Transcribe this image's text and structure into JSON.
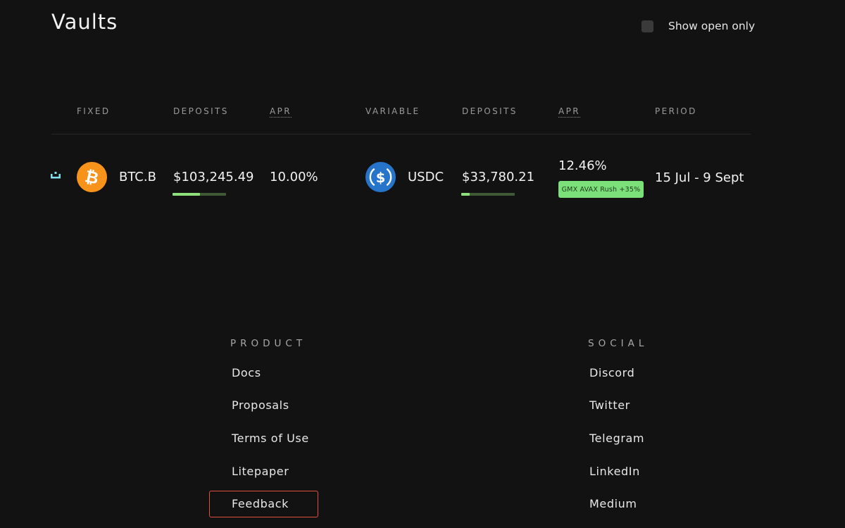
{
  "header": {
    "title": "Vaults",
    "show_open_only_label": "Show open only"
  },
  "table": {
    "headers": {
      "fixed": "FIXED",
      "fixed_deposits": "DEPOSITS",
      "fixed_apr": "APR",
      "variable": "VARIABLE",
      "variable_deposits": "DEPOSITS",
      "variable_apr": "APR",
      "period": "PERIOD"
    },
    "rows": [
      {
        "fixed_asset": "BTC.B",
        "fixed_asset_icon": "bitcoin-icon",
        "fixed_deposits": "$103,245.49",
        "fixed_deposits_progress": 0.51,
        "fixed_apr": "10.00%",
        "variable_asset": "USDC",
        "variable_asset_icon": "usdc-icon",
        "variable_deposits": "$33,780.21",
        "variable_deposits_progress": 0.16,
        "variable_apr": "12.46%",
        "variable_badge": "GMX AVAX Rush +35%",
        "period": "15 Jul - 9 Sept"
      }
    ]
  },
  "footer": {
    "product": {
      "heading": "PRODUCT",
      "links": [
        "Docs",
        "Proposals",
        "Terms of Use",
        "Litepaper",
        "Feedback"
      ]
    },
    "social": {
      "heading": "SOCIAL",
      "links": [
        "Discord",
        "Twitter",
        "Telegram",
        "LinkedIn",
        "Medium"
      ]
    }
  },
  "colors": {
    "background": "#121212",
    "accent_green": "#8ee07a",
    "bitcoin_orange": "#f7931a",
    "usdc_blue": "#2775ca",
    "highlight_red": "#e0503a"
  }
}
